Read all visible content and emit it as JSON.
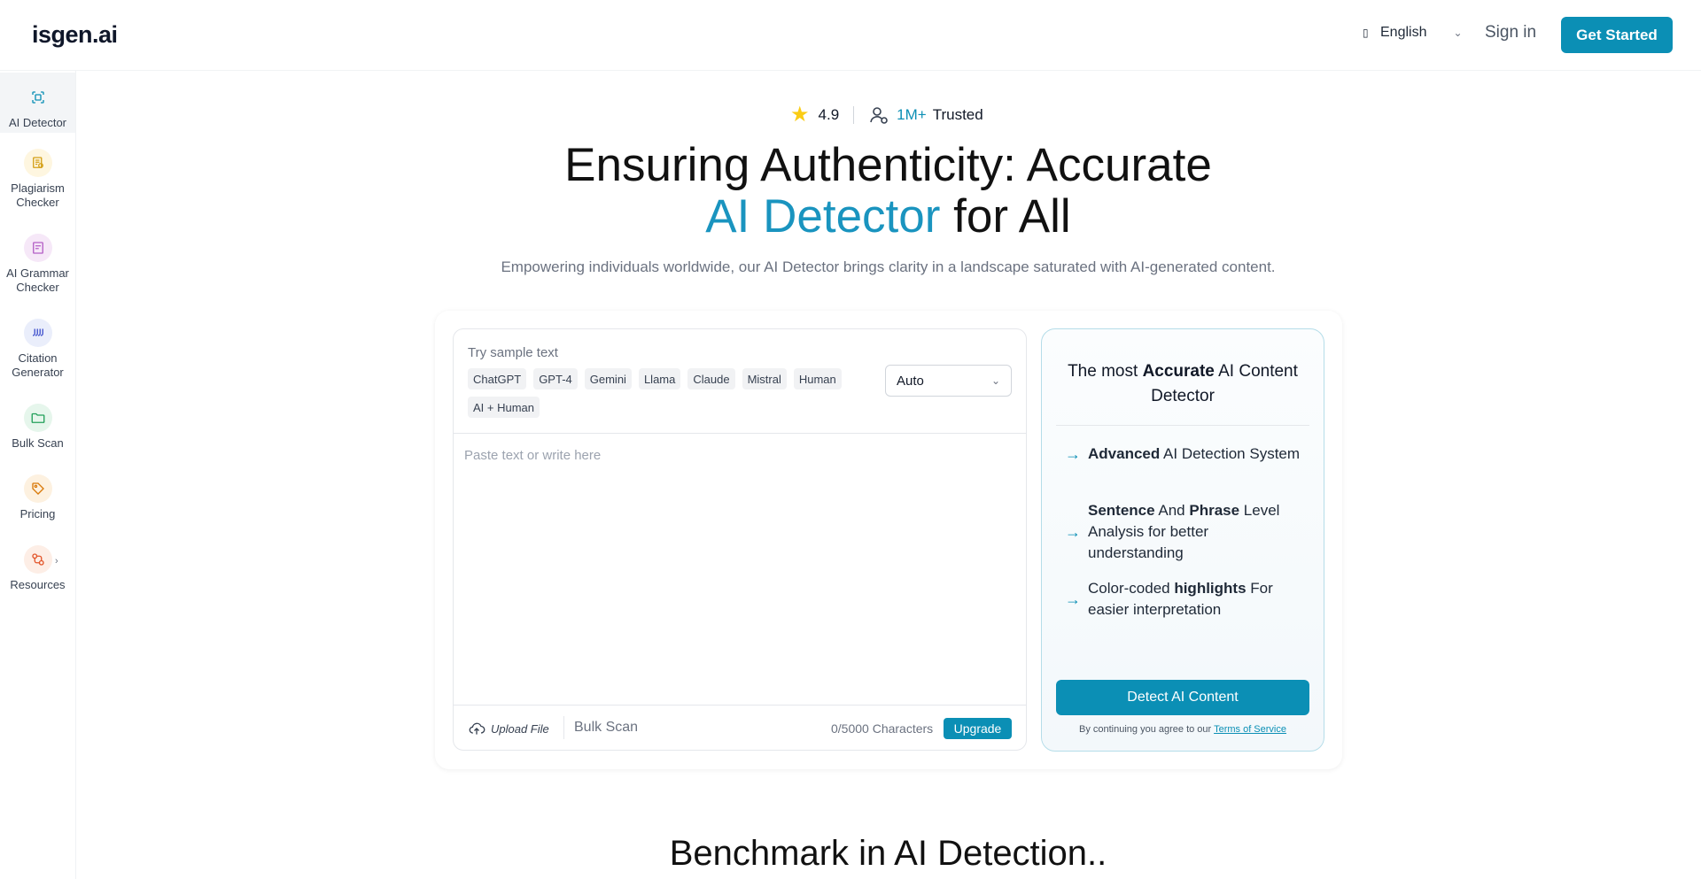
{
  "header": {
    "logo": "isgen.ai",
    "language": "English",
    "signin": "Sign in",
    "get_started": "Get Started"
  },
  "sidebar": {
    "items": [
      {
        "label": "AI Detector",
        "icon": "ai-detector-icon"
      },
      {
        "label": "Plagiarism Checker",
        "icon": "plagiarism-icon"
      },
      {
        "label": "AI Grammar Checker",
        "icon": "grammar-icon"
      },
      {
        "label": "Citation Generator",
        "icon": "quote-icon"
      },
      {
        "label": "Bulk Scan",
        "icon": "folder-icon"
      },
      {
        "label": "Pricing",
        "icon": "tag-icon"
      },
      {
        "label": "Resources",
        "icon": "resources-icon"
      }
    ]
  },
  "hero": {
    "rating": "4.9",
    "users_count": "1M+",
    "users_label": "Trusted",
    "title_line1": "Ensuring Authenticity: Accurate",
    "title_accent": "AI Detector",
    "title_rest": " for All",
    "subtitle": "Empowering individuals worldwide, our AI Detector brings clarity in a landscape saturated with AI-generated content."
  },
  "editor": {
    "sample_label": "Try sample text",
    "chips": [
      "ChatGPT",
      "GPT-4",
      "Gemini",
      "Llama",
      "Claude",
      "Mistral",
      "Human",
      "AI + Human"
    ],
    "model_select": "Auto",
    "placeholder": "Paste text or write here",
    "upload": "Upload File",
    "bulk_scan": "Bulk Scan",
    "char_count": "0/5000 Characters",
    "upgrade": "Upgrade"
  },
  "panel": {
    "title_pre": "The most ",
    "title_bold": "Accurate",
    "title_post": " AI Content Detector",
    "features": [
      {
        "bold": "Advanced",
        "text": " AI Detection System"
      },
      {
        "bold1": "Sentence",
        "mid": " And ",
        "bold2": "Phrase",
        "text": " Level Analysis for better understanding"
      },
      {
        "pre": "Color-coded ",
        "bold": "highlights",
        "text": " For easier interpretation"
      }
    ],
    "detect_button": "Detect AI Content",
    "terms_pre": "By continuing you agree to our ",
    "terms_link": "Terms of Service"
  },
  "benchmark_title": "Benchmark in AI Detection..",
  "colors": {
    "accent": "#0b8fb5",
    "star": "#facc15"
  }
}
